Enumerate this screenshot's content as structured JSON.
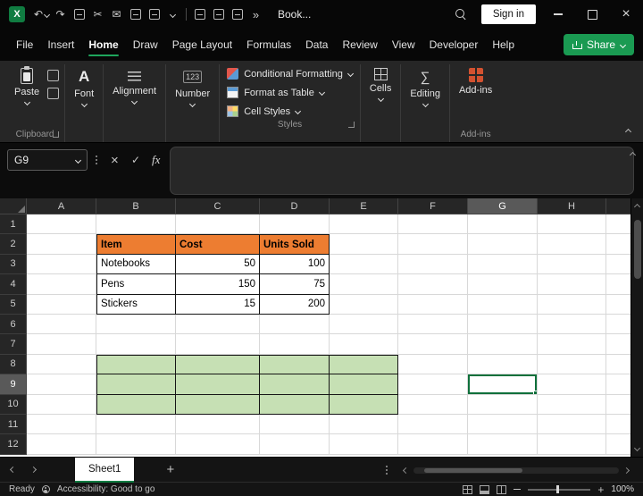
{
  "colors": {
    "excel_green": "#107C41",
    "share_green": "#1A9A52",
    "table_header_orange": "#ED7D31",
    "range_fill_green": "#C6E0B4",
    "selection_border_green": "#0F703B"
  },
  "titlebar": {
    "doc_title": "Book...",
    "sign_in_label": "Sign in",
    "quick_access_icons": [
      "undo",
      "redo",
      "copy",
      "cut",
      "mail",
      "print",
      "format-painter",
      "more-chevron",
      "save",
      "ruler",
      "table",
      "overflow"
    ]
  },
  "menu": {
    "items": [
      "File",
      "Insert",
      "Home",
      "Draw",
      "Page Layout",
      "Formulas",
      "Data",
      "Review",
      "View",
      "Developer",
      "Help"
    ],
    "active": "Home",
    "share_label": "Share"
  },
  "ribbon": {
    "paste_label": "Paste",
    "clipboard_label": "Clipboard",
    "font_label": "Font",
    "alignment_label": "Alignment",
    "number_label": "Number",
    "styles": {
      "conditional_formatting": "Conditional Formatting",
      "format_as_table": "Format as Table",
      "cell_styles": "Cell Styles",
      "label": "Styles"
    },
    "cells_label": "Cells",
    "editing_label": "Editing",
    "addins_label": "Add-ins",
    "addins_group_label": "Add-ins"
  },
  "formula_bar": {
    "name_box": "G9",
    "fx_label": "fx",
    "content": ""
  },
  "grid": {
    "columns": [
      "A",
      "B",
      "C",
      "D",
      "E",
      "F",
      "G",
      "H"
    ],
    "col_widths": {
      "A": 78,
      "B": 89,
      "C": 94,
      "D": 78,
      "E": 77,
      "F": 78,
      "G": 78,
      "H": 77
    },
    "rows": [
      1,
      2,
      3,
      4,
      5,
      6,
      7,
      8,
      9,
      10,
      11,
      12
    ],
    "selected": {
      "cell": "G9",
      "col": "G",
      "row": 9
    },
    "cells": {
      "B2": {
        "t": "Item",
        "cls": "hdr"
      },
      "C2": {
        "t": "Cost",
        "cls": "hdr"
      },
      "D2": {
        "t": "Units Sold",
        "cls": "hdr"
      },
      "B3": {
        "t": "Notebooks",
        "cls": "txt"
      },
      "C3": {
        "t": "50",
        "cls": "num"
      },
      "D3": {
        "t": "100",
        "cls": "num"
      },
      "B4": {
        "t": "Pens",
        "cls": "txt"
      },
      "C4": {
        "t": "150",
        "cls": "num"
      },
      "D4": {
        "t": "75",
        "cls": "num"
      },
      "B5": {
        "t": "Stickers",
        "cls": "txt"
      },
      "C5": {
        "t": "15",
        "cls": "num"
      },
      "D5": {
        "t": "200",
        "cls": "num"
      }
    },
    "table_range": {
      "cols": [
        "B",
        "C",
        "D"
      ],
      "rows": [
        2,
        3,
        4,
        5
      ]
    },
    "green_range": {
      "cols": [
        "B",
        "C",
        "D",
        "E"
      ],
      "rows": [
        8,
        9,
        10
      ]
    }
  },
  "sheet_bar": {
    "active_tab": "Sheet1",
    "add_label": "+"
  },
  "status_bar": {
    "ready": "Ready",
    "accessibility": "Accessibility: Good to go",
    "zoom": "100%"
  }
}
